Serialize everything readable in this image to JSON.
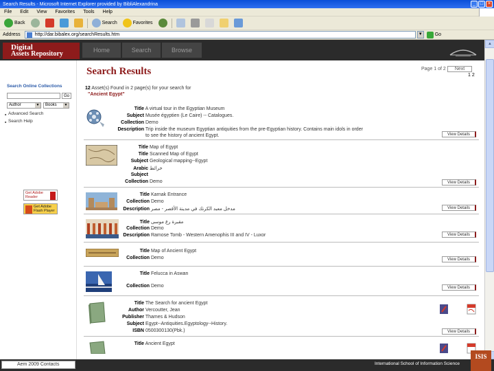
{
  "window": {
    "title": "Search Results - Microsoft Internet Explorer provided by BibliAlexandrina",
    "menu": [
      "File",
      "Edit",
      "View",
      "Favorites",
      "Tools",
      "Help"
    ],
    "toolbar": {
      "back": "Back",
      "search": "Search",
      "favorites": "Favorites"
    },
    "address": {
      "label": "Address",
      "url": "http://dar.bibalex.org/searchResults.htm",
      "go": "Go"
    }
  },
  "site": {
    "logo_line1": "Digital",
    "logo_line2": "Assets Repository",
    "nav": [
      "Home",
      "Search",
      "Browse"
    ]
  },
  "sidebar": {
    "title": "Search Online Collections",
    "go_label": "Go",
    "type_select": "Author",
    "coll_select": "Books",
    "links": [
      "Advanced Search",
      "Search Help"
    ],
    "badge_reader": "Get Adobe Reader",
    "badge_flash": "Get Adobe Flash Player"
  },
  "results_page": {
    "title": "Search Results",
    "pager_text": "Page 1 of 2",
    "next_label": "Next",
    "page_numbers": "1 2",
    "summary_count": "12",
    "summary_text": " Asset(s) Found in 2 page(s) for your search for",
    "query": "\"Ancient Egypt\"",
    "view_details": "View Details"
  },
  "results": [
    {
      "fields": [
        {
          "k": "Title",
          "v": "A virtual tour in the Egyptian Museum"
        },
        {
          "k": "Subject",
          "v": "Musée égyptien (Le Caire) -- Catalogues."
        },
        {
          "k": "Collection",
          "v": "Demo"
        },
        {
          "k": "Description",
          "v": "Trip inside the museum Egyptian antiquities from the pre-Egyptian history. Contains main idols in order"
        },
        {
          "k": "",
          "v": "to see the history of ancient Egypt."
        }
      ]
    },
    {
      "fields": [
        {
          "k": "Title",
          "v": "Map of Egypt"
        },
        {
          "k": "Title",
          "v": "Scanned Map of Egypt"
        },
        {
          "k": "Subject",
          "v": "Geological mapping--Egypt"
        },
        {
          "k": "Arabic",
          "v": "خرائط"
        },
        {
          "k": "Subject",
          "v": ""
        },
        {
          "k": "Collection",
          "v": "Demo"
        }
      ]
    },
    {
      "fields": [
        {
          "k": "Title",
          "v": "Karnak Entrance"
        },
        {
          "k": "Collection",
          "v": "Demo"
        },
        {
          "k": "Description",
          "v": "مدخل معبد الكرنك في مدينة الأقصر - مصر"
        }
      ]
    },
    {
      "fields": [
        {
          "k": "Title",
          "v": "مقبرة رع موسى"
        },
        {
          "k": "Collection",
          "v": "Demo"
        },
        {
          "k": "Description",
          "v": "Ramose Tomb - Western Amenophis III and IV - Luxor"
        }
      ]
    },
    {
      "fields": [
        {
          "k": "Title",
          "v": "Map of Ancient Egypt"
        },
        {
          "k": "Collection",
          "v": "Demo"
        }
      ]
    },
    {
      "fields": [
        {
          "k": "Title",
          "v": "Felucca in Aswan"
        },
        {
          "k": "Collection",
          "v": "Demo"
        }
      ]
    },
    {
      "fields": [
        {
          "k": "Title",
          "v": "The Search for ancient Egypt"
        },
        {
          "k": "Author",
          "v": "Vercoutter, Jean"
        },
        {
          "k": "Publisher",
          "v": "Thames & Hudson"
        },
        {
          "k": "Subject",
          "v": "Egypt--Antiquities.Egyptology--History."
        },
        {
          "k": "ISBN",
          "v": "0500300130(Pbk.)"
        }
      ]
    },
    {
      "fields": [
        {
          "k": "Title",
          "v": "Ancient Egypt"
        }
      ]
    }
  ],
  "statusbar": {
    "copyright": "Aem 2009  Contacts",
    "isis": "International School of Information Science",
    "isis_logo": "ISIS"
  }
}
